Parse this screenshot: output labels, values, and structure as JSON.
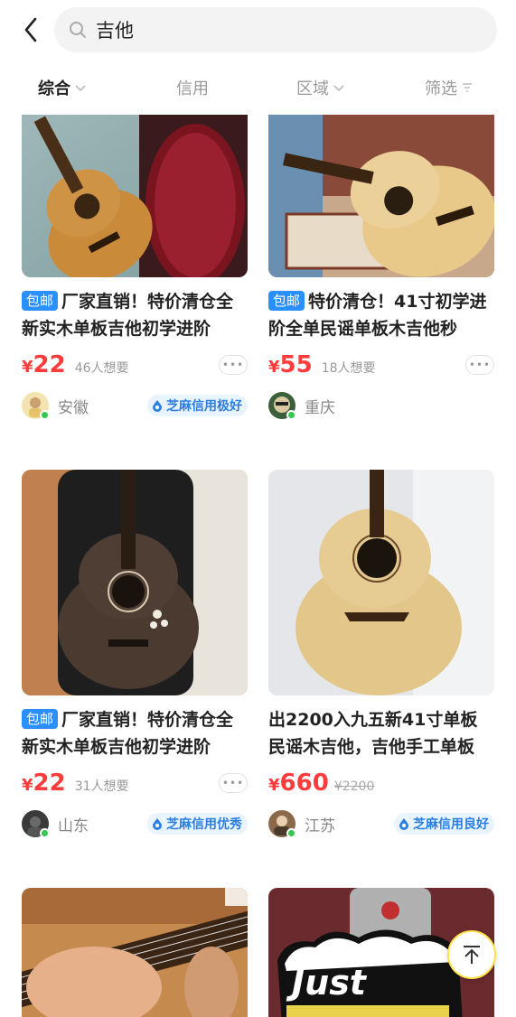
{
  "search": {
    "query": "吉他"
  },
  "filters": [
    {
      "label": "综合",
      "active": true,
      "has_chevron": true
    },
    {
      "label": "信用",
      "active": false,
      "has_chevron": false
    },
    {
      "label": "区域",
      "active": false,
      "has_chevron": true
    },
    {
      "label": "筛选",
      "active": false,
      "icon": "filter-icon"
    }
  ],
  "items": [
    {
      "badge": "包邮",
      "title": "厂家直销！特价清仓全新实木单板吉他初学进阶",
      "currency": "¥",
      "price": "22",
      "want": "46人想要",
      "location": "安徽",
      "credit": "芝麻信用极好"
    },
    {
      "badge": "包邮",
      "title": "特价清仓！41寸初学进阶全单民谣单板木吉他秒",
      "currency": "¥",
      "price": "55",
      "want": "18人想要",
      "location": "重庆",
      "credit": ""
    },
    {
      "badge": "包邮",
      "title": "厂家直销！特价清仓全新实木单板吉他初学进阶",
      "currency": "¥",
      "price": "22",
      "want": "31人想要",
      "location": "山东",
      "credit": "芝麻信用优秀"
    },
    {
      "badge": "",
      "title": "出2200入九五新41寸单板民谣木吉他，吉他手工单板",
      "currency": "¥",
      "price": "660",
      "original_price": "¥2200",
      "location": "江苏",
      "credit": "芝麻信用良好"
    }
  ],
  "partial_items": [
    {
      "image_text": "Just"
    }
  ],
  "more_label": "•••",
  "colors": {
    "price": "#ff3b3b",
    "badge": "#2a90ff",
    "credit": "#2a7fe0",
    "online": "#35c750"
  }
}
